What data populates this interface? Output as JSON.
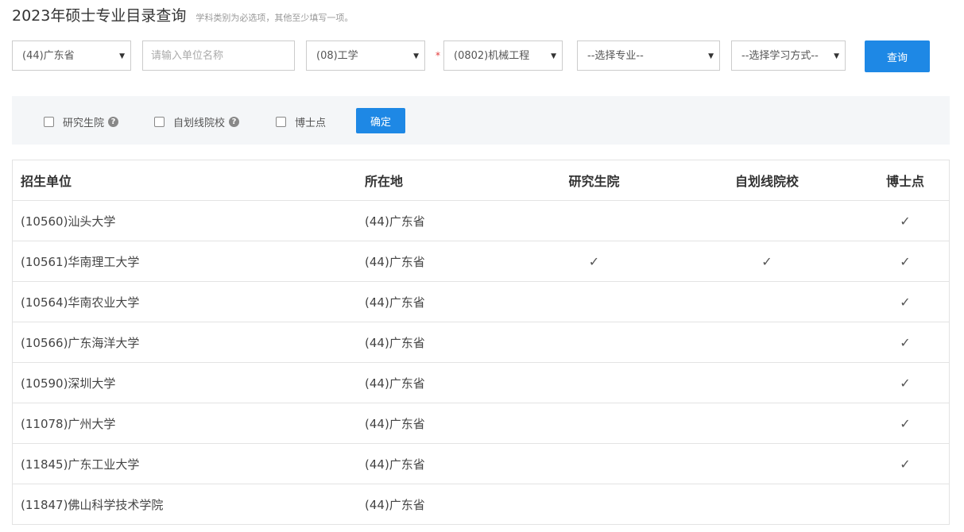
{
  "page": {
    "title": "2023年硕士专业目录查询",
    "hint": "学科类别为必选项，其他至少填写一项。"
  },
  "filters": {
    "province": "(44)广东省",
    "unit_placeholder": "请输入单位名称",
    "category": "(08)工学",
    "required_mark": "*",
    "discipline": "(0802)机械工程",
    "major": "--选择专业--",
    "study_mode": "--选择学习方式--",
    "query_label": "查询",
    "caret": "▼"
  },
  "options": {
    "grad_school": "研究生院",
    "self_marked": "自划线院校",
    "phd_point": "博士点",
    "confirm_label": "确定",
    "help_glyph": "?"
  },
  "table": {
    "headers": [
      "招生单位",
      "所在地",
      "研究生院",
      "自划线院校",
      "博士点"
    ],
    "check_glyph": "✓",
    "rows": [
      {
        "unit": "(10560)汕头大学",
        "location": "(44)广东省",
        "grad": false,
        "self": false,
        "phd": true
      },
      {
        "unit": "(10561)华南理工大学",
        "location": "(44)广东省",
        "grad": true,
        "self": true,
        "phd": true
      },
      {
        "unit": "(10564)华南农业大学",
        "location": "(44)广东省",
        "grad": false,
        "self": false,
        "phd": true
      },
      {
        "unit": "(10566)广东海洋大学",
        "location": "(44)广东省",
        "grad": false,
        "self": false,
        "phd": true
      },
      {
        "unit": "(10590)深圳大学",
        "location": "(44)广东省",
        "grad": false,
        "self": false,
        "phd": true
      },
      {
        "unit": "(11078)广州大学",
        "location": "(44)广东省",
        "grad": false,
        "self": false,
        "phd": true
      },
      {
        "unit": "(11845)广东工业大学",
        "location": "(44)广东省",
        "grad": false,
        "self": false,
        "phd": true
      },
      {
        "unit": "(11847)佛山科学技术学院",
        "location": "(44)广东省",
        "grad": false,
        "self": false,
        "phd": false
      }
    ]
  },
  "colors": {
    "accent": "#1e88e5",
    "required": "#e23b3b",
    "panel_bg": "#f4f6f8"
  }
}
